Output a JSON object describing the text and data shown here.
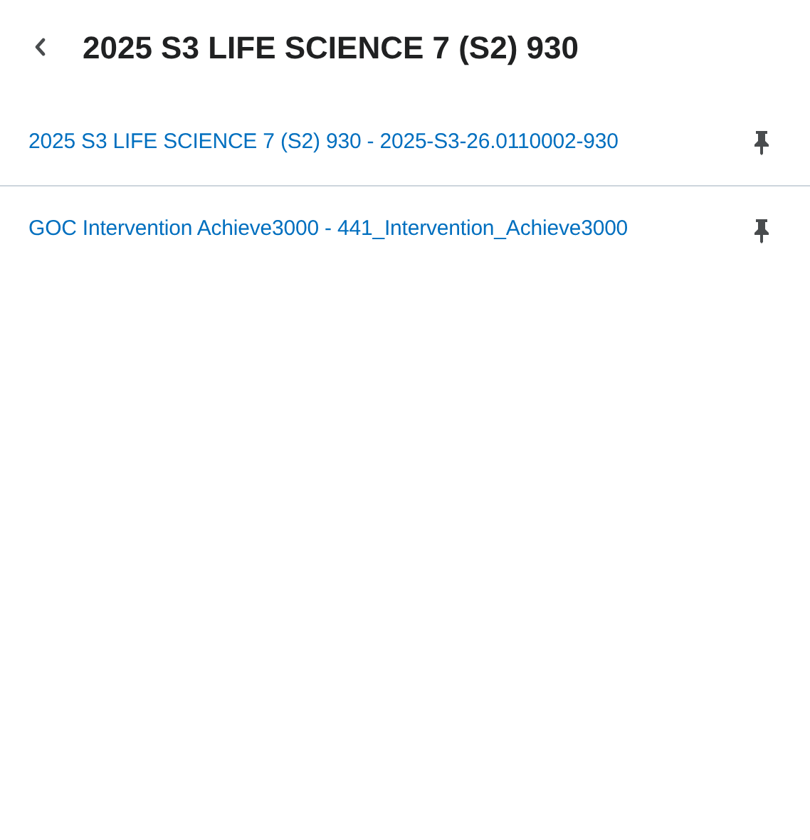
{
  "header": {
    "title": "2025 S3 LIFE SCIENCE 7 (S2) 930"
  },
  "courses": [
    {
      "label": "2025 S3 LIFE SCIENCE 7 (S2) 930 - 2025-S3-26.0110002-930"
    },
    {
      "label": "GOC Intervention Achieve3000 - 441_Intervention_Achieve3000"
    }
  ]
}
